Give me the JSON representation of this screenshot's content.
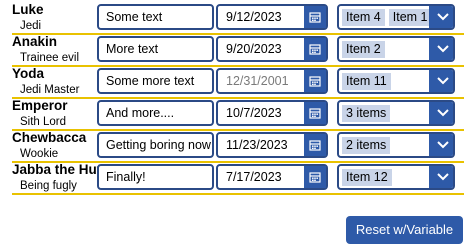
{
  "rows": [
    {
      "name": "Luke",
      "title": "Jedi",
      "text": "Some text",
      "date": "9/12/2023",
      "date_is_placeholder": false,
      "items": [
        "Item 4",
        "Item 1"
      ]
    },
    {
      "name": "Anakin",
      "title": "Trainee evil",
      "text": "More text",
      "date": "9/20/2023",
      "date_is_placeholder": false,
      "items": [
        "Item 2"
      ]
    },
    {
      "name": "Yoda",
      "title": "Jedi Master",
      "text": "Some more text",
      "date": "12/31/2001",
      "date_is_placeholder": true,
      "items": [
        "Item 11"
      ]
    },
    {
      "name": "Emperor",
      "title": "Sith Lord",
      "text": "And more....",
      "date": "10/7/2023",
      "date_is_placeholder": false,
      "items": [
        "3 items"
      ]
    },
    {
      "name": "Chewbacca",
      "title": "Wookie",
      "text": "Getting boring now",
      "date": "11/23/2023",
      "date_is_placeholder": false,
      "items": [
        "2 items"
      ]
    },
    {
      "name": "Jabba the Hutt",
      "title": "Being fugly",
      "text": "Finally!",
      "date": "7/17/2023",
      "date_is_placeholder": false,
      "items": [
        "Item 12"
      ]
    }
  ],
  "reset_button": {
    "label": "Reset w/Variable"
  },
  "colors": {
    "accent": "#2e5aa8",
    "border": "#2b4a86",
    "chip": "#c9d4e8",
    "row_separator": "#e9c200"
  },
  "icons": {
    "date": "calendar-icon",
    "combo": "chevron-down-icon"
  }
}
